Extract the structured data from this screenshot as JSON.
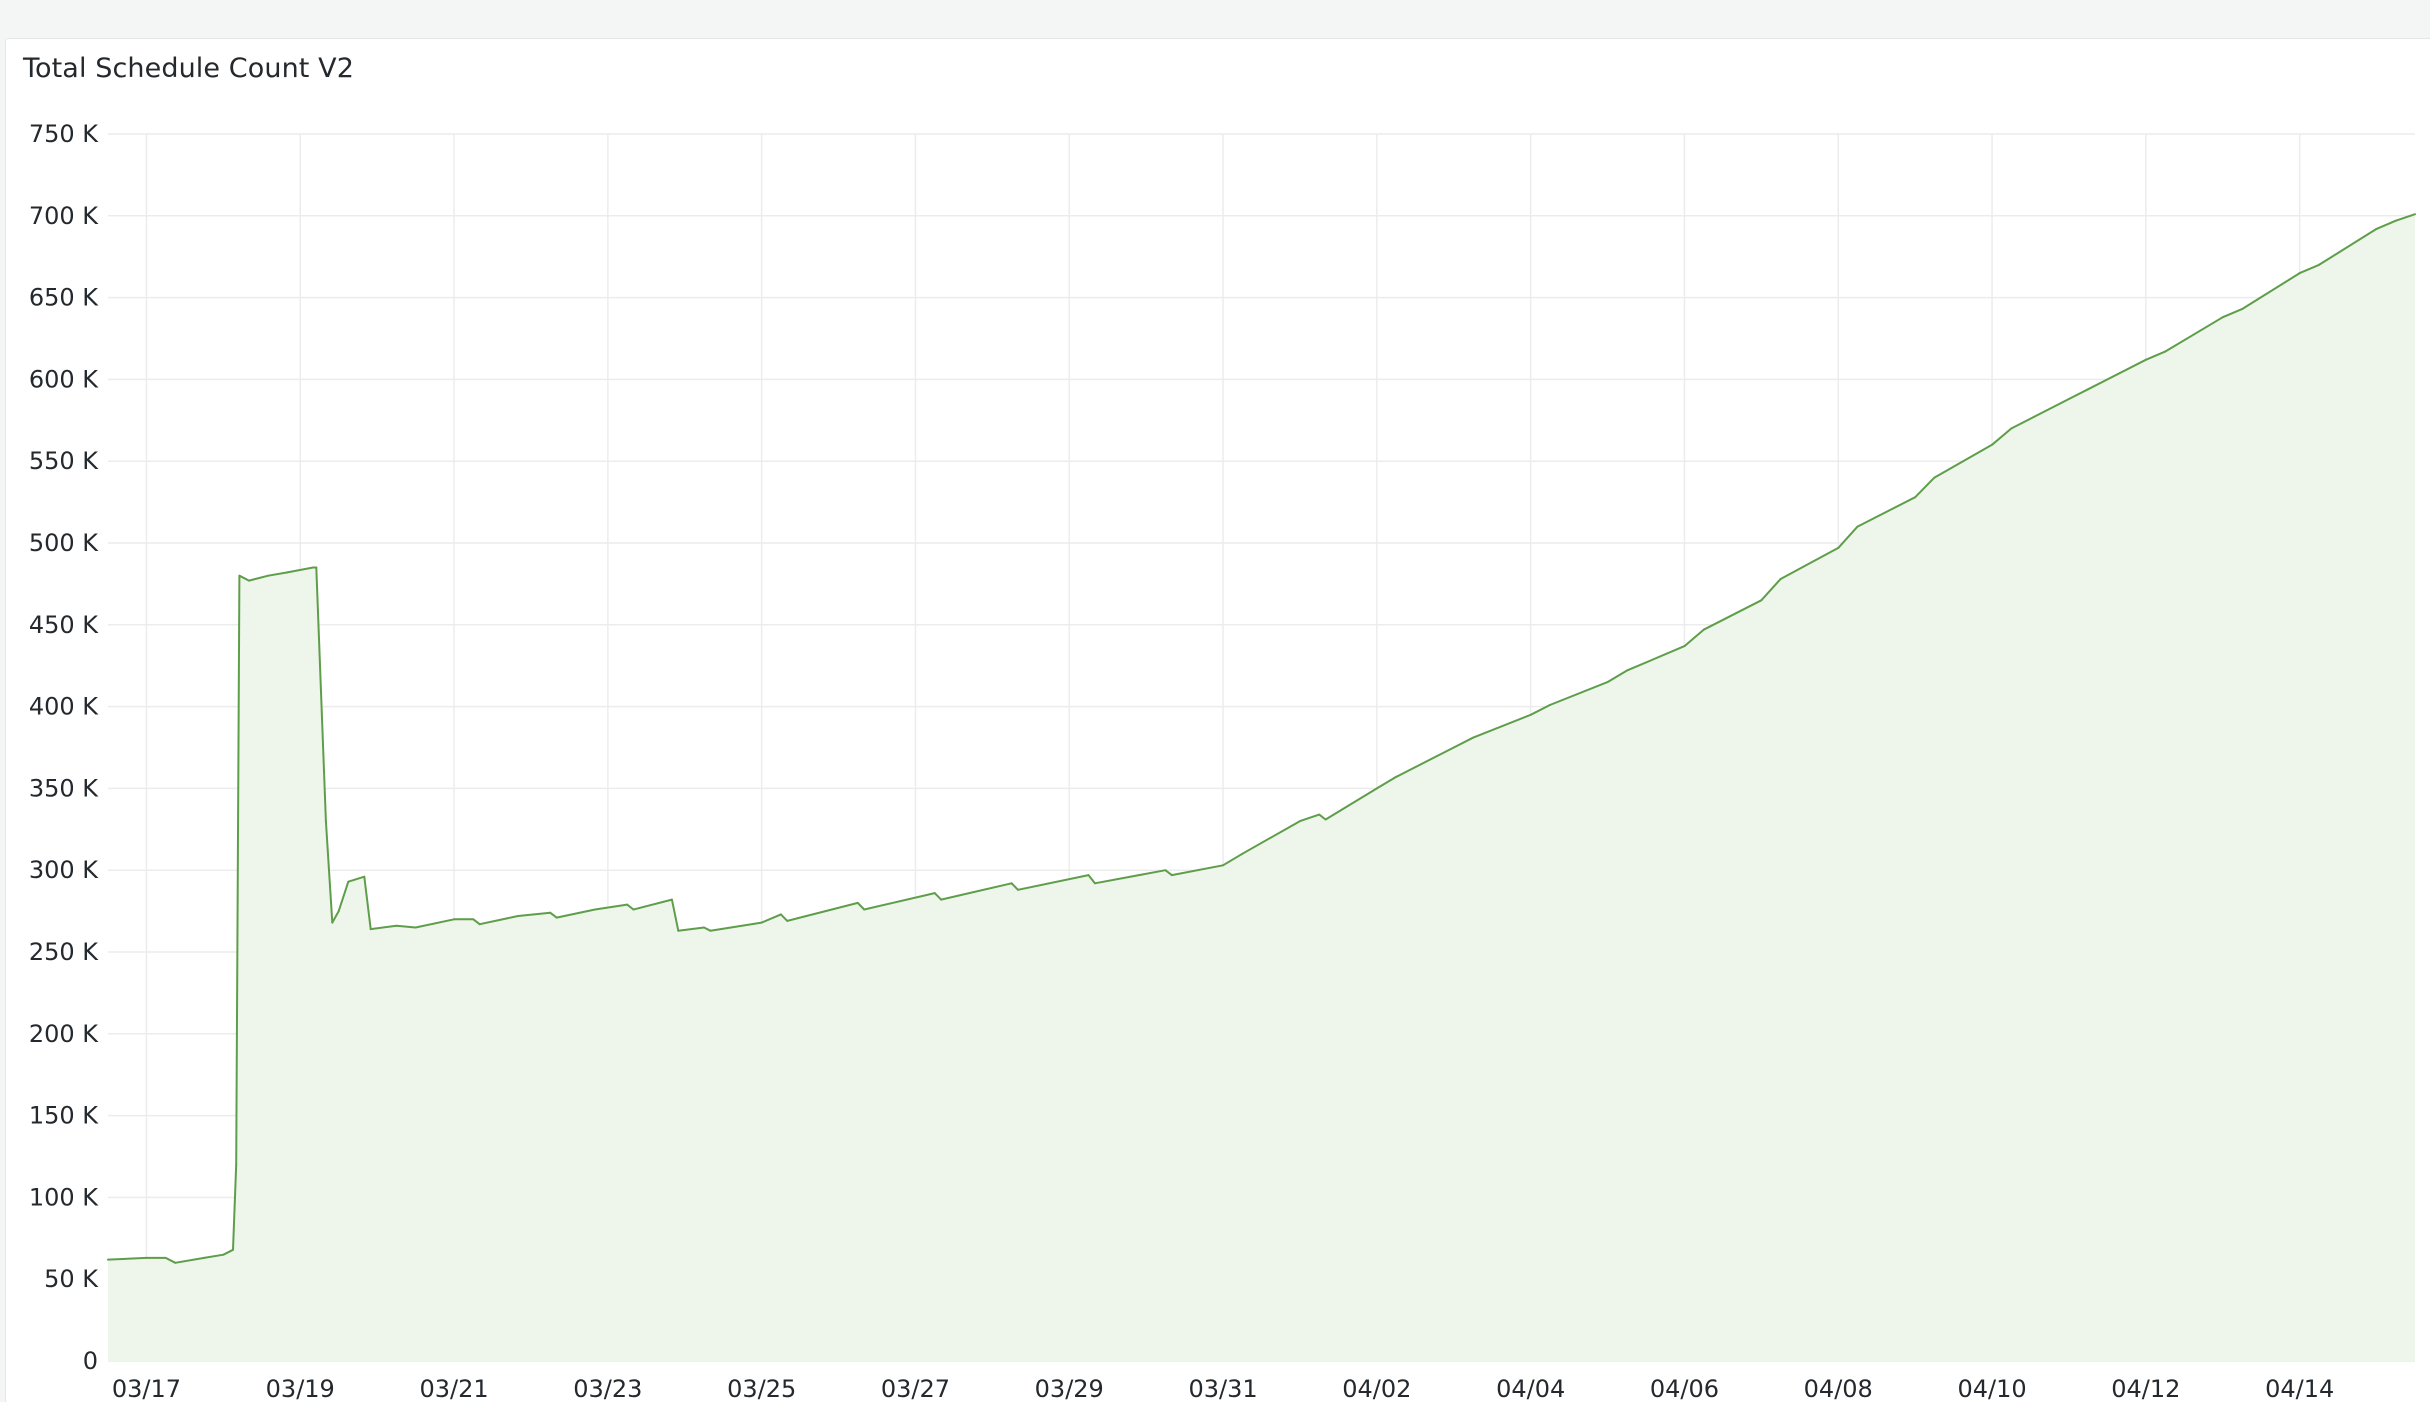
{
  "panel": {
    "title": "Total Schedule Count V2"
  },
  "colors": {
    "line": "#5e9e4a",
    "fill": "#eef5ea",
    "grid": "#ececec",
    "text": "#24292e"
  },
  "chart_data": {
    "type": "area",
    "title": "Total Schedule Count V2",
    "xlabel": "",
    "ylabel": "",
    "ylim": [
      0,
      750000
    ],
    "y_ticks": [
      0,
      50000,
      100000,
      150000,
      200000,
      250000,
      300000,
      350000,
      400000,
      450000,
      500000,
      550000,
      600000,
      650000,
      700000,
      750000
    ],
    "y_tick_labels": [
      "0",
      "50 K",
      "100 K",
      "150 K",
      "200 K",
      "250 K",
      "300 K",
      "350 K",
      "400 K",
      "450 K",
      "500 K",
      "550 K",
      "600 K",
      "650 K",
      "700 K",
      "750 K"
    ],
    "x_tick_labels": [
      "03/17",
      "03/19",
      "03/21",
      "03/23",
      "03/25",
      "03/27",
      "03/29",
      "03/31",
      "04/02",
      "04/04",
      "04/06",
      "04/08",
      "04/10",
      "04/12",
      "04/14"
    ],
    "x_ticks": [
      "2025-03-17 00:00",
      "2025-03-19 00:00",
      "2025-03-21 00:00",
      "2025-03-23 00:00",
      "2025-03-25 00:00",
      "2025-03-27 00:00",
      "2025-03-29 00:00",
      "2025-03-31 00:00",
      "2025-04-02 00:00",
      "2025-04-04 00:00",
      "2025-04-06 00:00",
      "2025-04-08 00:00",
      "2025-04-10 00:00",
      "2025-04-12 00:00",
      "2025-04-14 00:00"
    ],
    "xlim": [
      "2025-03-16 12:00",
      "2025-04-15 12:00"
    ],
    "grid": true,
    "legend": "none",
    "series": [
      {
        "points": [
          [
            "2025-03-16 12:00",
            62000
          ],
          [
            "2025-03-17 00:00",
            63000
          ],
          [
            "2025-03-17 06:00",
            63000
          ],
          [
            "2025-03-17 09:00",
            60000
          ],
          [
            "2025-03-17 18:00",
            63000
          ],
          [
            "2025-03-18 00:00",
            65000
          ],
          [
            "2025-03-18 03:00",
            68000
          ],
          [
            "2025-03-18 04:00",
            120000
          ],
          [
            "2025-03-18 05:00",
            480000
          ],
          [
            "2025-03-18 08:00",
            477000
          ],
          [
            "2025-03-18 14:00",
            480000
          ],
          [
            "2025-03-18 20:00",
            482000
          ],
          [
            "2025-03-19 04:00",
            485000
          ],
          [
            "2025-03-19 05:00",
            485000
          ],
          [
            "2025-03-19 08:00",
            330000
          ],
          [
            "2025-03-19 10:00",
            268000
          ],
          [
            "2025-03-19 12:00",
            275000
          ],
          [
            "2025-03-19 15:00",
            293000
          ],
          [
            "2025-03-19 20:00",
            296000
          ],
          [
            "2025-03-19 22:00",
            264000
          ],
          [
            "2025-03-20 06:00",
            266000
          ],
          [
            "2025-03-20 12:00",
            265000
          ],
          [
            "2025-03-21 00:00",
            270000
          ],
          [
            "2025-03-21 06:00",
            270000
          ],
          [
            "2025-03-21 08:00",
            267000
          ],
          [
            "2025-03-21 20:00",
            272000
          ],
          [
            "2025-03-22 06:00",
            274000
          ],
          [
            "2025-03-22 08:00",
            271000
          ],
          [
            "2025-03-22 20:00",
            276000
          ],
          [
            "2025-03-23 06:00",
            279000
          ],
          [
            "2025-03-23 08:00",
            276000
          ],
          [
            "2025-03-23 20:00",
            282000
          ],
          [
            "2025-03-23 22:00",
            263000
          ],
          [
            "2025-03-24 06:00",
            265000
          ],
          [
            "2025-03-24 08:00",
            263000
          ],
          [
            "2025-03-25 00:00",
            268000
          ],
          [
            "2025-03-25 06:00",
            273000
          ],
          [
            "2025-03-25 08:00",
            269000
          ],
          [
            "2025-03-26 06:00",
            280000
          ],
          [
            "2025-03-26 08:00",
            276000
          ],
          [
            "2025-03-27 06:00",
            286000
          ],
          [
            "2025-03-27 08:00",
            282000
          ],
          [
            "2025-03-28 06:00",
            292000
          ],
          [
            "2025-03-28 08:00",
            288000
          ],
          [
            "2025-03-29 06:00",
            297000
          ],
          [
            "2025-03-29 08:00",
            292000
          ],
          [
            "2025-03-30 06:00",
            300000
          ],
          [
            "2025-03-30 08:00",
            297000
          ],
          [
            "2025-03-31 00:00",
            303000
          ],
          [
            "2025-03-31 06:00",
            310000
          ],
          [
            "2025-04-01 00:00",
            330000
          ],
          [
            "2025-04-01 06:00",
            334000
          ],
          [
            "2025-04-01 08:00",
            331000
          ],
          [
            "2025-04-02 00:00",
            350000
          ],
          [
            "2025-04-02 06:00",
            357000
          ],
          [
            "2025-04-03 00:00",
            375000
          ],
          [
            "2025-04-03 06:00",
            381000
          ],
          [
            "2025-04-04 00:00",
            395000
          ],
          [
            "2025-04-04 06:00",
            401000
          ],
          [
            "2025-04-05 00:00",
            415000
          ],
          [
            "2025-04-05 06:00",
            422000
          ],
          [
            "2025-04-06 00:00",
            437000
          ],
          [
            "2025-04-06 06:00",
            447000
          ],
          [
            "2025-04-07 00:00",
            465000
          ],
          [
            "2025-04-07 06:00",
            478000
          ],
          [
            "2025-04-08 00:00",
            497000
          ],
          [
            "2025-04-08 06:00",
            510000
          ],
          [
            "2025-04-09 00:00",
            528000
          ],
          [
            "2025-04-09 06:00",
            540000
          ],
          [
            "2025-04-10 00:00",
            560000
          ],
          [
            "2025-04-10 06:00",
            570000
          ],
          [
            "2025-04-11 00:00",
            588000
          ],
          [
            "2025-04-11 06:00",
            594000
          ],
          [
            "2025-04-12 00:00",
            612000
          ],
          [
            "2025-04-12 06:00",
            617000
          ],
          [
            "2025-04-13 00:00",
            638000
          ],
          [
            "2025-04-13 06:00",
            643000
          ],
          [
            "2025-04-14 00:00",
            665000
          ],
          [
            "2025-04-14 06:00",
            670000
          ],
          [
            "2025-04-15 00:00",
            692000
          ],
          [
            "2025-04-15 06:00",
            697000
          ],
          [
            "2025-04-15 12:00",
            701000
          ]
        ]
      }
    ]
  }
}
